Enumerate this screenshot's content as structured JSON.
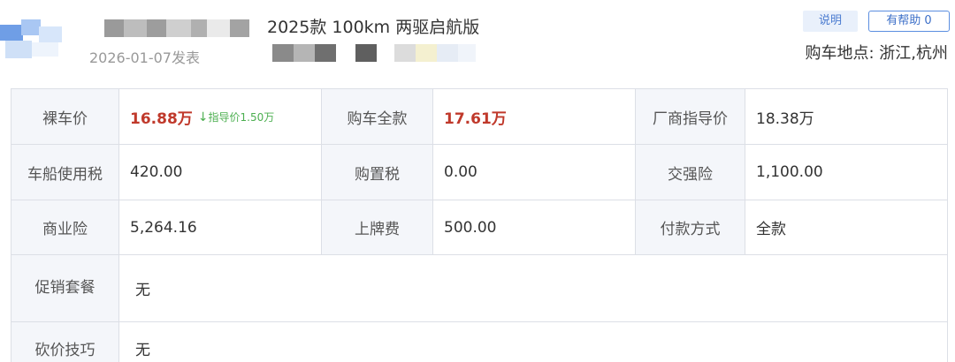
{
  "header": {
    "date": "2026-01-07发表",
    "car_title": "2025款 100km 两驱启航版",
    "explain_label": "说明",
    "helpful_label": "有帮助 0",
    "location": "购车地点: 浙江,杭州"
  },
  "table": {
    "rows": [
      [
        {
          "label": "裸车价",
          "value": "16.88万",
          "note": "指导价1.50万"
        },
        {
          "label": "购车全款",
          "value": "17.61万"
        },
        {
          "label": "厂商指导价",
          "value": "18.38万"
        }
      ],
      [
        {
          "label": "车船使用税",
          "value": "420.00"
        },
        {
          "label": "购置税",
          "value": "0.00"
        },
        {
          "label": "交强险",
          "value": "1,100.00"
        }
      ],
      [
        {
          "label": "商业险",
          "value": "5,264.16"
        },
        {
          "label": "上牌费",
          "value": "500.00"
        },
        {
          "label": "付款方式",
          "value": "全款"
        }
      ]
    ],
    "promo": {
      "label": "促销套餐",
      "value": "无"
    },
    "bargain": {
      "label": "砍价技巧",
      "value": "无"
    }
  },
  "colors": {
    "accent_red": "#c0392b",
    "guide_green": "#4caf50",
    "label_bg": "#f4f6fa",
    "border": "#dcdfe6"
  },
  "icons": {
    "down_arrow": "arrow-down-icon"
  }
}
